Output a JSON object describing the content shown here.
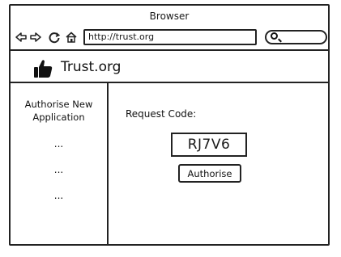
{
  "window": {
    "title": "Browser"
  },
  "toolbar": {
    "back_icon": "back-arrow-icon",
    "forward_icon": "forward-arrow-icon",
    "reload_icon": "reload-icon",
    "home_icon": "home-icon",
    "address": "http://trust.org",
    "search_value": "",
    "search_icon": "search-icon"
  },
  "site": {
    "logo_icon": "thumbs-up-icon",
    "title": "Trust.org"
  },
  "sidebar": {
    "link_label": "Authorise New Application",
    "more_items": [
      "...",
      "...",
      "..."
    ]
  },
  "main": {
    "request_label": "Request Code:",
    "request_code": "RJ7V6",
    "authorise_label": "Authorise"
  }
}
